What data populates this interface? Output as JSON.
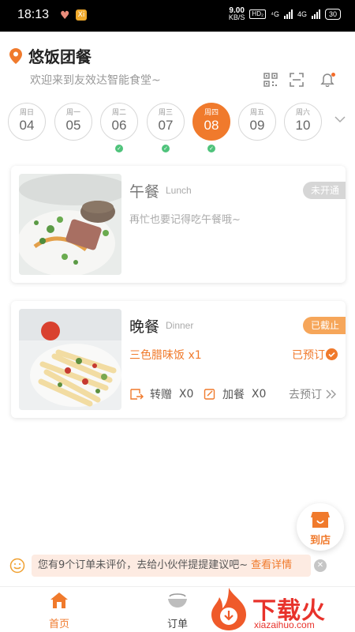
{
  "status_bar": {
    "time": "18:13",
    "net_speed_value": "9.00",
    "net_speed_unit": "KB/S",
    "hd_badge": "HD₂",
    "signal1": "⁴G",
    "signal2": "4G",
    "battery": "30",
    "app_badge": "Xi"
  },
  "header": {
    "title": "悠饭团餐",
    "subtitle": "欢迎来到友效达智能食堂~"
  },
  "week": {
    "days": [
      {
        "label": "周日",
        "date": "04",
        "active": false,
        "booked": false
      },
      {
        "label": "周一",
        "date": "05",
        "active": false,
        "booked": false
      },
      {
        "label": "周二",
        "date": "06",
        "active": false,
        "booked": true
      },
      {
        "label": "周三",
        "date": "07",
        "active": false,
        "booked": true
      },
      {
        "label": "周四",
        "date": "08",
        "active": true,
        "booked": true
      },
      {
        "label": "周五",
        "date": "09",
        "active": false,
        "booked": false
      },
      {
        "label": "周六",
        "date": "10",
        "active": false,
        "booked": false
      }
    ]
  },
  "lunch": {
    "name": "午餐",
    "name_en": "Lunch",
    "status": "未开通",
    "message": "再忙也要记得吃午餐哦~"
  },
  "dinner": {
    "name": "晚餐",
    "name_en": "Dinner",
    "status": "已截止",
    "dish": "三色腊味饭 x1",
    "booked_label": "已预订",
    "gift_label": "转赠",
    "gift_count": "X0",
    "add_label": "加餐",
    "add_count": "X0",
    "goto_label": "去预订"
  },
  "to_store": {
    "label": "到店"
  },
  "notice": {
    "text": "您有9个订单未评价，去给小伙伴提提建议吧~",
    "link": "查看详情"
  },
  "tabbar": {
    "home": "首页",
    "orders": "订单"
  },
  "watermark": {
    "text": "下载火",
    "sub": "xiazaihuo.com"
  },
  "colors": {
    "accent": "#f07a2c",
    "success": "#4fc37b",
    "closed_tag": "#d6d6d6",
    "cutoff_tag": "#f6a65a"
  }
}
